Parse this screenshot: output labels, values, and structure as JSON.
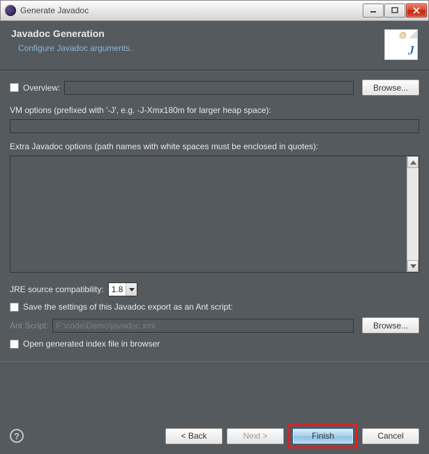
{
  "window": {
    "title": "Generate Javadoc"
  },
  "banner": {
    "heading": "Javadoc Generation",
    "subheading": "Configure Javadoc arguments."
  },
  "overview": {
    "label": "Overview:",
    "value": "",
    "browse": "Browse..."
  },
  "vm": {
    "label": "VM options (prefixed with '-J', e.g. -J-Xmx180m for larger heap space):",
    "value": ""
  },
  "extra": {
    "label": "Extra Javadoc options (path names with white spaces must be enclosed in quotes):",
    "value": ""
  },
  "jre": {
    "label": "JRE source compatibility:",
    "value": "1.8"
  },
  "save_ant": {
    "label": "Save the settings of this Javadoc export as an Ant script:"
  },
  "ant_script": {
    "label": "Ant Script:",
    "value": "F:\\code\\Demo\\javadoc.xml",
    "browse": "Browse..."
  },
  "open_index": {
    "label": "Open generated index file in browser"
  },
  "buttons": {
    "back": "< Back",
    "next": "Next >",
    "finish": "Finish",
    "cancel": "Cancel"
  }
}
